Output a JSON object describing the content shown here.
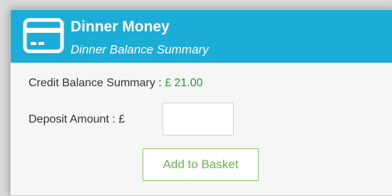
{
  "header": {
    "title": "Dinner Money",
    "subtitle": "Dinner Balance Summary",
    "icon": "credit-card-icon"
  },
  "balance": {
    "label": "Credit Balance Summary : ",
    "value": "£ 21.00"
  },
  "deposit": {
    "label": "Deposit Amount : £",
    "value": "",
    "placeholder": ""
  },
  "actions": {
    "add_to_basket_label": "Add to Basket"
  },
  "colors": {
    "header_bg": "#1badd8",
    "balance_value": "#22a12a",
    "button_text": "#6db34f",
    "button_border": "#8cc36e"
  }
}
